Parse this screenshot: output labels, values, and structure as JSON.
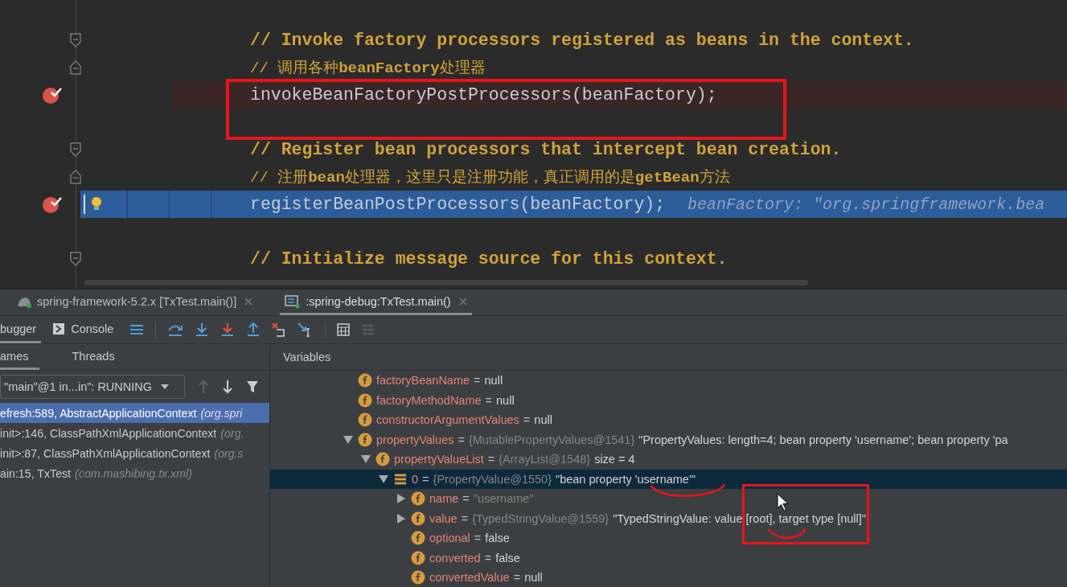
{
  "editor": {
    "lines": [
      {
        "kind": "comment",
        "text": "// Invoke factory processors registered as beans in the context."
      },
      {
        "kind": "comment_mixed",
        "text": "// 调用各种**beanFactory**处理器"
      },
      {
        "kind": "code",
        "text": "invokeBeanFactoryPostProcessors(beanFactory);",
        "breakpoint": true,
        "current": false
      },
      {
        "kind": "blank"
      },
      {
        "kind": "comment",
        "text": "// Register bean processors that intercept bean creation."
      },
      {
        "kind": "comment_mixed",
        "text": "// 注册**bean**处理器，这里只是注册功能，真正调用的是**getBean**方法"
      },
      {
        "kind": "code",
        "text": "registerBeanPostProcessors(beanFactory);",
        "hint": "beanFactory: \"org.springframework.bea",
        "breakpoint": true,
        "current": true
      },
      {
        "kind": "blank"
      },
      {
        "kind": "comment",
        "text": "// Initialize message source for this context."
      }
    ]
  },
  "run_tabs": [
    {
      "label": "spring-framework-5.2.x [TxTest.main()]",
      "selected": false
    },
    {
      "label": ":spring-debug:TxTest.main()",
      "selected": true
    }
  ],
  "debug_tabs": [
    {
      "label": "bugger",
      "selected": true
    },
    {
      "label": "Console",
      "selected": false
    }
  ],
  "frames_tabs": [
    {
      "label": "ames",
      "selected": true
    },
    {
      "label": "Threads",
      "selected": false
    }
  ],
  "thread_select": "\"main\"@1 in...in\": RUNNING",
  "frames": [
    {
      "method": "efresh:589, AbstractApplicationContext",
      "location": "(org.spri",
      "selected": true
    },
    {
      "method": "init>:146, ClassPathXmlApplicationContext",
      "location": "(org.",
      "selected": false
    },
    {
      "method": "init>:87, ClassPathXmlApplicationContext",
      "location": "(org.s",
      "selected": false
    },
    {
      "method": "ain:15, TxTest",
      "location": "(com.mashibing.tx.xml)",
      "selected": false
    }
  ],
  "variables_title": "Variables",
  "variables": [
    {
      "kind": "field",
      "name": "factoryBeanName",
      "sep": "=",
      "value": "null",
      "selected": false
    },
    {
      "kind": "field",
      "name": "factoryMethodName",
      "sep": "=",
      "value": "null",
      "selected": false
    },
    {
      "kind": "field",
      "name": "constructorArgumentValues",
      "sep": "=",
      "value": "null",
      "selected": false
    },
    {
      "kind": "field",
      "name": "propertyValues",
      "sep": "=",
      "ref": "{MutablePropertyValues@1541}",
      "value": "\"PropertyValues: length=4; bean property 'username'; bean property 'pa",
      "expanded": true,
      "selected": false,
      "children": [
        {
          "kind": "field",
          "name": "propertyValueList",
          "sep": "=",
          "ref": "{ArrayList@1548}",
          "value": "size = 4",
          "expanded": true,
          "selected": false,
          "children": [
            {
              "kind": "element",
              "name": "0",
              "sep": "=",
              "ref": "{PropertyValue@1550}",
              "value": "\"bean property 'username'\"",
              "expanded": true,
              "selected": true,
              "children": [
                {
                  "kind": "string",
                  "name": "name",
                  "sep": "=",
                  "value": "\"username\"",
                  "expanded": false,
                  "selected": false
                },
                {
                  "kind": "field",
                  "name": "value",
                  "sep": "=",
                  "ref": "{TypedStringValue@1559}",
                  "value": "\"TypedStringValue: value [root], target type [null]\"",
                  "expanded": false,
                  "selected": false
                },
                {
                  "kind": "field",
                  "name": "optional",
                  "sep": "=",
                  "value": "false",
                  "selected": false
                },
                {
                  "kind": "field",
                  "name": "converted",
                  "sep": "=",
                  "value": "false",
                  "selected": false
                },
                {
                  "kind": "field",
                  "name": "convertedValue",
                  "sep": "=",
                  "value": "null",
                  "selected": false
                }
              ]
            }
          ]
        }
      ]
    }
  ]
}
